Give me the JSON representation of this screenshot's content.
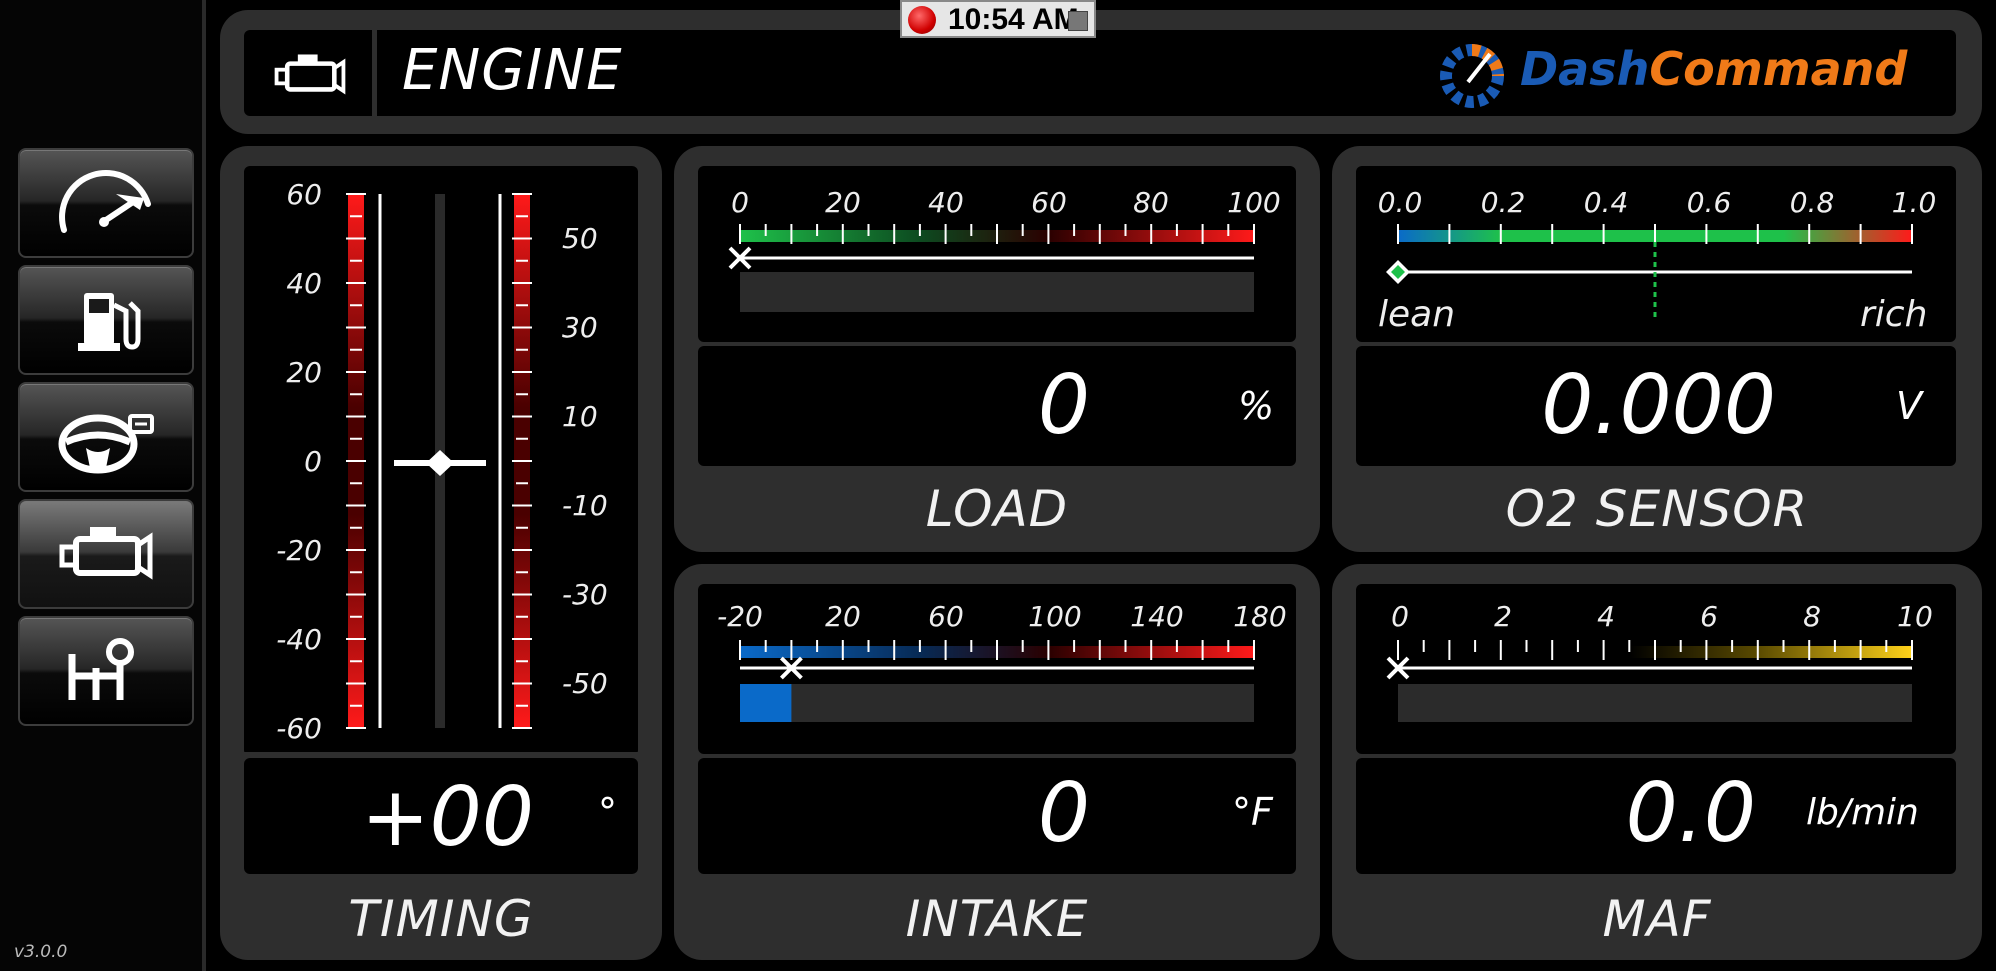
{
  "version": "v3.0.0",
  "status_bar": {
    "time": "10:54 AM"
  },
  "header": {
    "title": "ENGINE",
    "brand_part1": "Dash",
    "brand_part2": "Command"
  },
  "sidebar": {
    "items": [
      {
        "icon": "speedometer-icon"
      },
      {
        "icon": "fuel-pump-icon"
      },
      {
        "icon": "steering-wheel-icon"
      },
      {
        "icon": "engine-icon",
        "active": true
      },
      {
        "icon": "gear-shift-icon"
      }
    ]
  },
  "gauges": {
    "timing": {
      "title": "TIMING",
      "value": "+00",
      "unit": "°",
      "left_ticks": [
        "60",
        "40",
        "20",
        "0",
        "-20",
        "-40",
        "-60"
      ],
      "right_ticks": [
        "50",
        "30",
        "10",
        "-10",
        "-30",
        "-50"
      ],
      "level": 0
    },
    "load": {
      "title": "LOAD",
      "value": "0",
      "unit": "%",
      "ticks": [
        "0",
        "20",
        "40",
        "60",
        "80",
        "100"
      ],
      "level": 0
    },
    "o2": {
      "title": "O2 SENSOR",
      "value": "0.000",
      "unit": "V",
      "ticks": [
        "0.0",
        "0.2",
        "0.4",
        "0.6",
        "0.8",
        "1.0"
      ],
      "left_label": "lean",
      "right_label": "rich",
      "level": 0
    },
    "intake": {
      "title": "INTAKE",
      "value": "0",
      "unit": "°F",
      "ticks": [
        "-20",
        "20",
        "60",
        "100",
        "140",
        "180"
      ],
      "level": 0.1
    },
    "maf": {
      "title": "MAF",
      "value": "0.0",
      "unit": "lb/min",
      "ticks": [
        "0",
        "2",
        "4",
        "6",
        "8",
        "10"
      ],
      "level": 0
    }
  },
  "colors": {
    "accent_blue": "#1a5bb5",
    "accent_orange": "#f07a18",
    "bar_blue": "#0a6ac9"
  }
}
